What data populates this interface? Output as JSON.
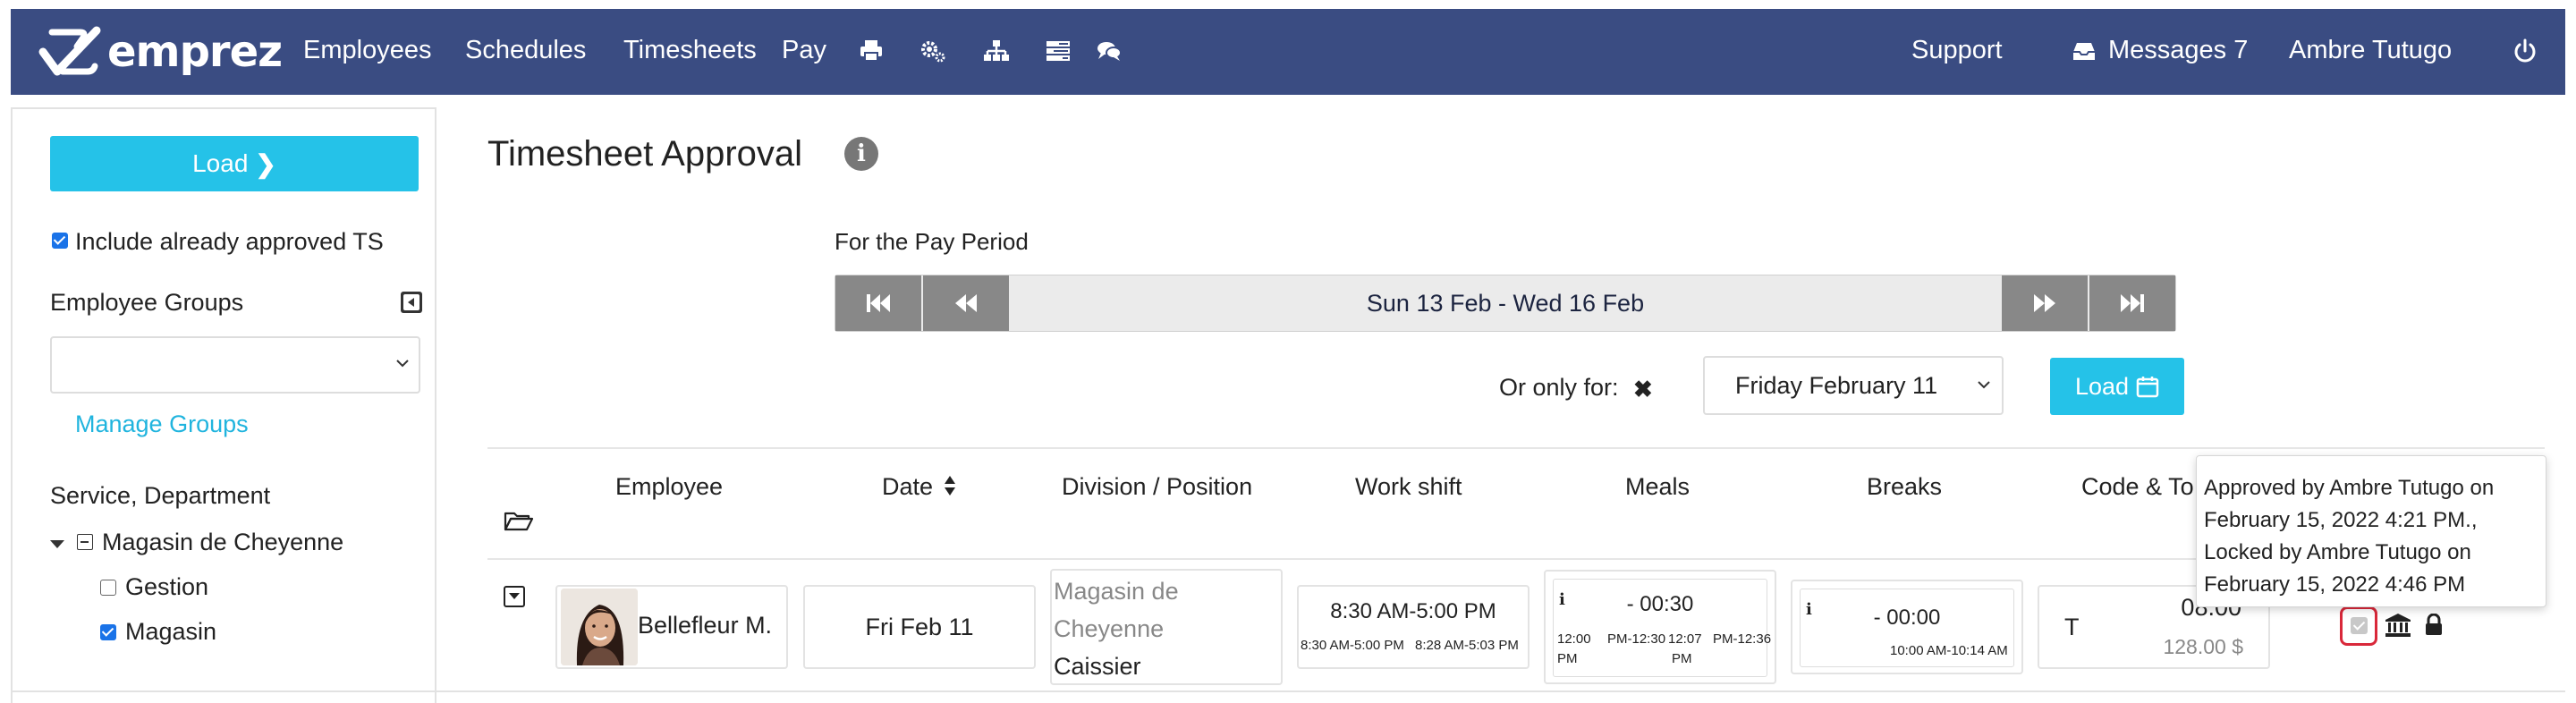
{
  "nav": {
    "brand": "emprez",
    "links": [
      "Employees",
      "Schedules",
      "Timesheets",
      "Pay"
    ],
    "icons": [
      "print-icon",
      "cogs-icon",
      "sitemap-icon",
      "tasks-icon",
      "comments-icon"
    ],
    "support": "Support",
    "messages": "Messages 7",
    "user": "Ambre Tutugo"
  },
  "sidebar": {
    "load_label": "Load",
    "include_approved": "Include already approved TS",
    "include_approved_checked": true,
    "employee_groups_label": "Employee Groups",
    "employee_groups_value": "",
    "manage_groups": "Manage Groups",
    "service_label": "Service, Department",
    "tree": {
      "root": "Magasin de Cheyenne",
      "children": [
        {
          "label": "Gestion",
          "checked": false
        },
        {
          "label": "Magasin",
          "checked": true
        }
      ]
    }
  },
  "main": {
    "title": "Timesheet Approval",
    "pay_period_label": "For the Pay Period",
    "pay_period_range": "Sun 13 Feb - Wed 16 Feb",
    "only_for_label": "Or only for:",
    "only_for_value": "Friday February 11",
    "load_label": "Load"
  },
  "table": {
    "headers": [
      "Employee",
      "Date",
      "Division / Position",
      "Work shift",
      "Meals",
      "Breaks",
      "Code & To"
    ],
    "rows": [
      {
        "employee": "Bellefleur M.",
        "date": "Fri Feb 11",
        "division": "Magasin de Cheyenne",
        "position": "Caissier",
        "work_shift": "8:30 AM-5:00 PM",
        "work_shift_sched": "8:30 AM-5:00 PM",
        "work_shift_punch": "8:28 AM-5:03 PM",
        "meals_total": "- 00:30",
        "meal_sched_1": "12:00",
        "meal_sched_2": "PM",
        "meal_sched_3": "PM-12:30",
        "meal_punch_1": "12:07",
        "meal_punch_2": "PM-12:36",
        "meal_punch_3": "PM",
        "breaks_total": "- 00:00",
        "break_punch": "10:00 AM-10:14 AM",
        "code": "T",
        "hours": "08.00",
        "amount": "128.00 $"
      }
    ]
  },
  "tooltip": {
    "line1": "Approved by Ambre Tutugo on",
    "line2": "February 15, 2022 4:21 PM.,",
    "line3": "Locked by Ambre Tutugo on",
    "line4": "February 15, 2022 4:46 PM"
  },
  "colors": {
    "nav_bg": "#3a4c82",
    "accent": "#25c2e8",
    "link": "#20b4de",
    "highlight_ring": "#d9283a"
  }
}
